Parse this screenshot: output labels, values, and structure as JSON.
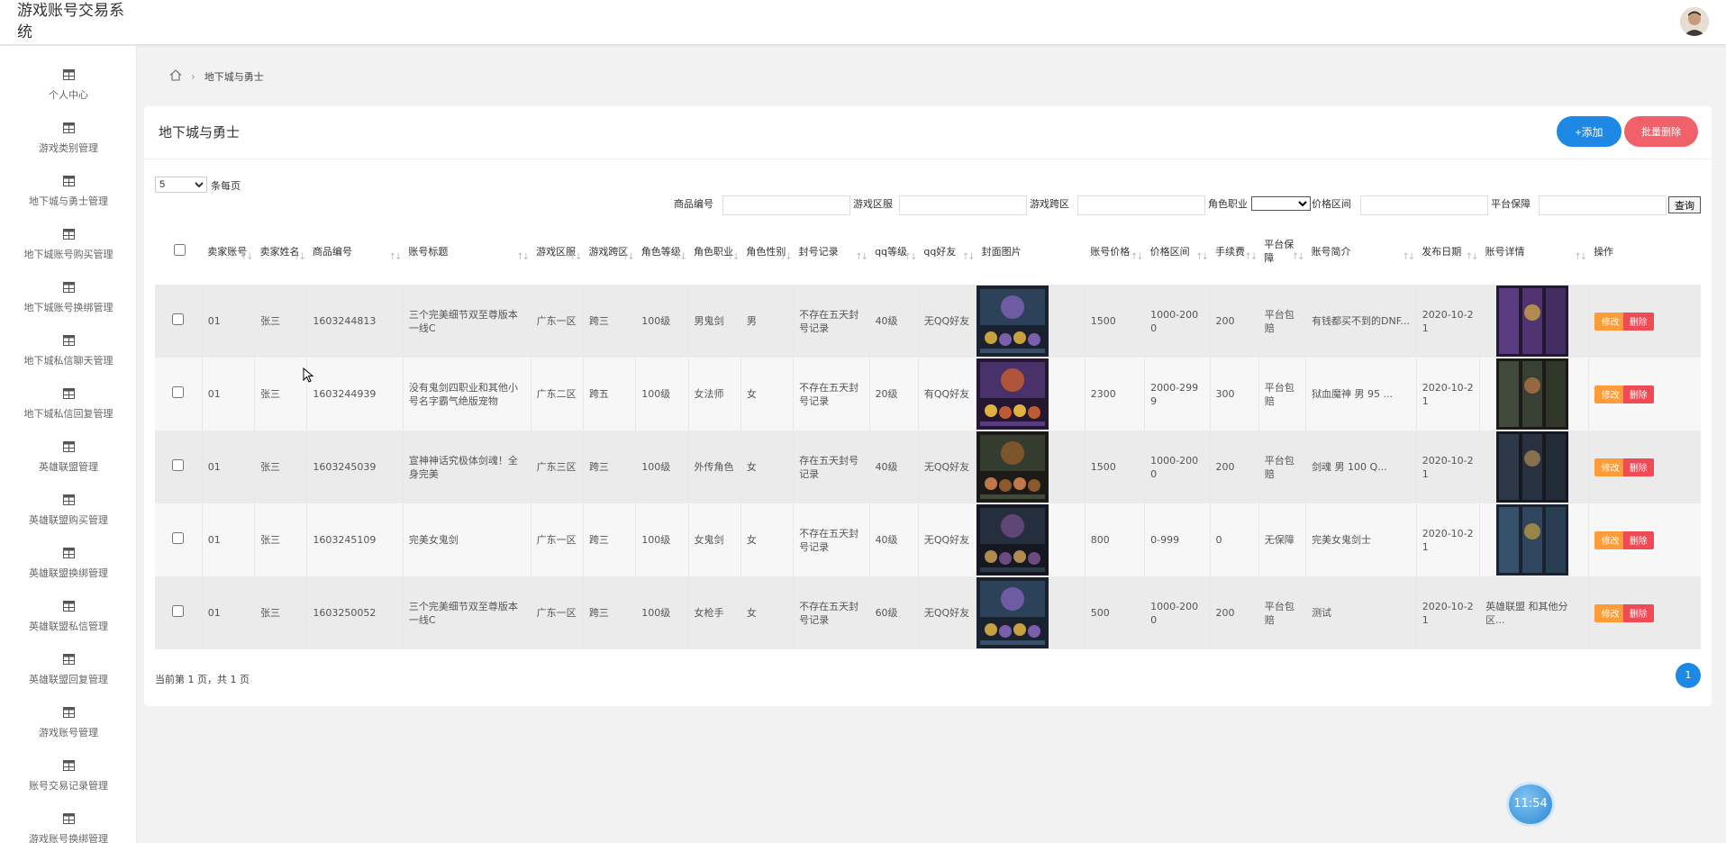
{
  "app": {
    "title": "游戏账号交易系统"
  },
  "sidebar": {
    "items": [
      {
        "label": "个人中心"
      },
      {
        "label": "游戏类别管理"
      },
      {
        "label": "地下城与勇士管理"
      },
      {
        "label": "地下城账号购买管理"
      },
      {
        "label": "地下城账号换绑管理"
      },
      {
        "label": "地下城私信聊天管理"
      },
      {
        "label": "地下城私信回复管理"
      },
      {
        "label": "英雄联盟管理"
      },
      {
        "label": "英雄联盟购买管理"
      },
      {
        "label": "英雄联盟换绑管理"
      },
      {
        "label": "英雄联盟私信管理"
      },
      {
        "label": "英雄联盟回复管理"
      },
      {
        "label": "游戏账号管理"
      },
      {
        "label": "账号交易记录管理"
      },
      {
        "label": "游戏账号换绑管理"
      }
    ]
  },
  "breadcrumb": {
    "current": "地下城与勇士"
  },
  "card": {
    "title": "地下城与勇士",
    "add_label": "+添加",
    "batch_delete_label": "批量删除"
  },
  "page_size": {
    "value": "5",
    "label": "条每页"
  },
  "filters": {
    "product_no": "商品编号",
    "game_server": "游戏区服",
    "cross_server": "游戏跨区",
    "role_class": "角色职业",
    "price_range": "价格区间",
    "platform_guarantee": "平台保障",
    "query_label": "查询"
  },
  "table": {
    "headers": [
      "卖家账号",
      "卖家姓名",
      "商品编号",
      "账号标题",
      "游戏区服",
      "游戏跨区",
      "角色等级",
      "角色职业",
      "角色性别",
      "封号记录",
      "qq等级",
      "qq好友",
      "封面图片",
      "账号价格",
      "价格区间",
      "手续费",
      "平台保障",
      "账号简介",
      "发布日期",
      "账号详情",
      "操作"
    ],
    "rows": [
      {
        "seller_account": "01",
        "seller_name": "张三",
        "product_no": "1603244813",
        "title": "三个完美细节双至尊版本一线C",
        "server": "广东一区",
        "cross": "跨三",
        "level": "100级",
        "class": "男鬼剑",
        "gender": "男",
        "ban": "不存在五天封号记录",
        "qq_level": "40级",
        "qq_friend": "无QQ好友",
        "price": "1500",
        "price_range": "1000-2000",
        "fee": "200",
        "guarantee": "平台包赔",
        "intro": "有钱都买不到的DNF...",
        "date": "2020-10-21",
        "detail": ""
      },
      {
        "seller_account": "01",
        "seller_name": "张三",
        "product_no": "1603244939",
        "title": "没有鬼剑四职业和其他小号名字霸气绝版宠物",
        "server": "广东二区",
        "cross": "跨五",
        "level": "100级",
        "class": "女法师",
        "gender": "女",
        "ban": "不存在五天封号记录",
        "qq_level": "20级",
        "qq_friend": "有QQ好友",
        "price": "2300",
        "price_range": "2000-2999",
        "fee": "300",
        "guarantee": "平台包赔",
        "intro": "狱血魔神 男 95 ...",
        "date": "2020-10-21",
        "detail": ""
      },
      {
        "seller_account": "01",
        "seller_name": "张三",
        "product_no": "1603245039",
        "title": "宣神神话究极体剑魂！全身完美",
        "server": "广东三区",
        "cross": "跨三",
        "level": "100级",
        "class": "外传角色",
        "gender": "女",
        "ban": "存在五天封号记录",
        "qq_level": "40级",
        "qq_friend": "无QQ好友",
        "price": "1500",
        "price_range": "1000-2000",
        "fee": "200",
        "guarantee": "平台包赔",
        "intro": "剑魂 男 100 Q...",
        "date": "2020-10-21",
        "detail": ""
      },
      {
        "seller_account": "01",
        "seller_name": "张三",
        "product_no": "1603245109",
        "title": "完美女鬼剑",
        "server": "广东一区",
        "cross": "跨三",
        "level": "100级",
        "class": "女鬼剑",
        "gender": "女",
        "ban": "不存在五天封号记录",
        "qq_level": "40级",
        "qq_friend": "无QQ好友",
        "price": "800",
        "price_range": "0-999",
        "fee": "0",
        "guarantee": "无保障",
        "intro": "完美女鬼剑士",
        "date": "2020-10-21",
        "detail": ""
      },
      {
        "seller_account": "01",
        "seller_name": "张三",
        "product_no": "1603250052",
        "title": "三个完美细节双至尊版本一线C",
        "server": "广东一区",
        "cross": "跨三",
        "level": "100级",
        "class": "女枪手",
        "gender": "女",
        "ban": "不存在五天封号记录",
        "qq_level": "60级",
        "qq_friend": "无QQ好友",
        "price": "500",
        "price_range": "1000-2000",
        "fee": "200",
        "guarantee": "平台包赔",
        "intro": "测试",
        "date": "2020-10-21",
        "detail": "英雄联盟 和其他分区..."
      }
    ],
    "edit_label": "修改",
    "delete_label": "删除"
  },
  "pager": {
    "info": "当前第 1 页，共 1 页",
    "current": "1"
  },
  "clock": {
    "time": "11:54"
  },
  "colors": {
    "primary": "#1e88e5",
    "danger": "#f0616a",
    "warning": "#ff9c3a"
  }
}
